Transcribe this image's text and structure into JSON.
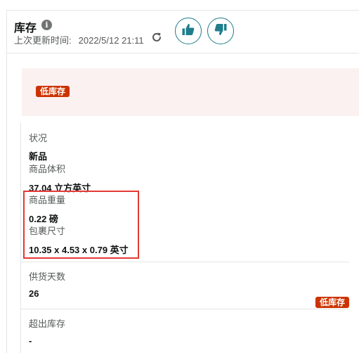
{
  "header": {
    "title": "库存",
    "info_icon": "info-icon",
    "updated_label": "上次更新时间:",
    "updated_time": "2022/5/12 21:11",
    "refresh_icon": "refresh-icon",
    "thumbs_up_icon": "thumbs-up-icon",
    "thumbs_down_icon": "thumbs-down-icon"
  },
  "alert": {
    "badge": "低库存"
  },
  "details": {
    "condition_label": "状况",
    "condition_value": "新品",
    "volume_label": "商品体积",
    "volume_value": "37.04 立方英寸",
    "weight_label": "商品重量",
    "weight_value": "0.22 磅",
    "package_label": "包裹尺寸",
    "package_value": "10.35 x 4.53 x 0.79 英寸",
    "supply_days_label": "供货天数",
    "supply_days_value": "26",
    "supply_badge": "低库存",
    "excess_label": "超出库存",
    "excess_value": "-"
  },
  "colors": {
    "accent": "#1f7d8c",
    "badge": "#cc3300",
    "alert_bg": "#fcf1f1",
    "highlight": "#e53935"
  }
}
